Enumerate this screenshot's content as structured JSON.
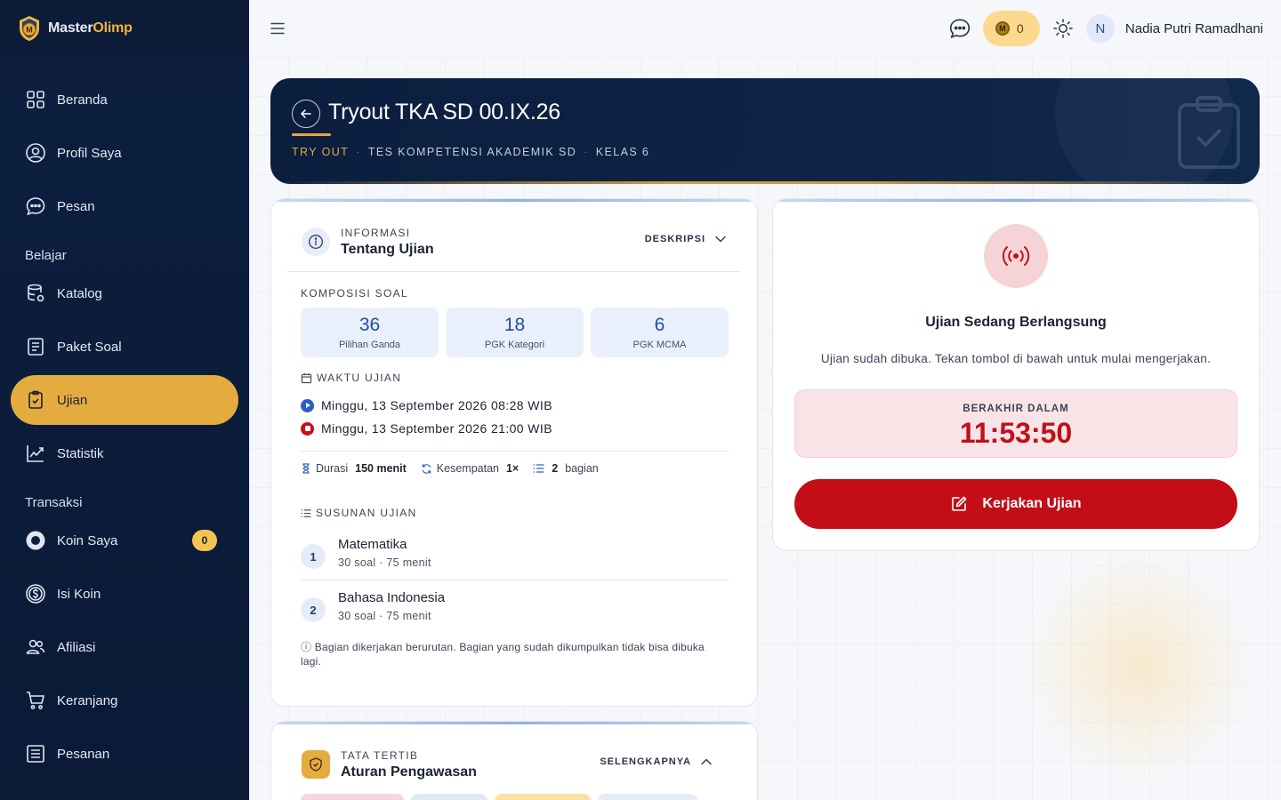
{
  "brand": {
    "name_a": "Master",
    "name_b": "Olimp"
  },
  "sidebar": {
    "items": [
      {
        "label": "Beranda"
      },
      {
        "label": "Profil Saya"
      },
      {
        "label": "Pesan"
      }
    ],
    "section_belajar": "Belajar",
    "belajar_items": [
      {
        "label": "Katalog"
      },
      {
        "label": "Paket Soal"
      },
      {
        "label": "Ujian"
      },
      {
        "label": "Statistik"
      }
    ],
    "section_transaksi": "Transaksi",
    "transaksi_items": [
      {
        "label": "Koin Saya",
        "badge": "0"
      },
      {
        "label": "Isi Koin"
      },
      {
        "label": "Afiliasi"
      },
      {
        "label": "Keranjang"
      },
      {
        "label": "Pesanan"
      }
    ]
  },
  "topbar": {
    "coin_count": "0",
    "coin_glyph": "M",
    "avatar_initial": "N",
    "user_name": "Nadia Putri Ramadhani"
  },
  "hero": {
    "title": "Tryout TKA SD 00.IX.26",
    "tag": "TRY OUT",
    "subject": "TES KOMPETENSI AKADEMIK SD",
    "grade": "KELAS 6",
    "sep": "·"
  },
  "info": {
    "kicker": "INFORMASI",
    "title": "Tentang Ujian",
    "action": "DESKRIPSI",
    "composition_label": "KOMPOSISI SOAL",
    "composition": [
      {
        "value": "36",
        "label": "Pilihan Ganda"
      },
      {
        "value": "18",
        "label": "PGK Kategori"
      },
      {
        "value": "6",
        "label": "PGK MCMA"
      }
    ],
    "time_label": "WAKTU UJIAN",
    "start_time": "Minggu, 13 September 2026 08:28 WIB",
    "end_time": "Minggu, 13 September 2026 21:00 WIB",
    "duration_prefix": "Durasi",
    "duration_value": "150 menit",
    "attempts_prefix": "Kesempatan",
    "attempts_value": "1×",
    "parts_value": "2",
    "parts_suffix": "bagian",
    "structure_label": "SUSUNAN UJIAN",
    "parts": [
      {
        "num": "1",
        "title": "Matematika",
        "sub": "30 soal · 75 menit"
      },
      {
        "num": "2",
        "title": "Bahasa Indonesia",
        "sub": "30 soal · 75 menit"
      }
    ],
    "note": "Bagian dikerjakan berurutan. Bagian yang sudah dikumpulkan tidak bisa dibuka lagi."
  },
  "rules": {
    "kicker": "TATA TERTIB",
    "title": "Aturan Pengawasan",
    "action": "SELENGKAPNYA"
  },
  "exam": {
    "title": "Ujian Sedang Berlangsung",
    "desc": "Ujian sudah dibuka. Tekan tombol di bawah untuk mulai mengerjakan.",
    "countdown_label": "BERAKHIR DALAM",
    "countdown": "11:53:50",
    "button": "Kerjakan Ujian"
  },
  "colors": {
    "sidebar": "#0d1f3f",
    "accent_gold": "#e4ac3f",
    "danger": "#c30e18",
    "primary_blue": "#1f4e9c"
  }
}
